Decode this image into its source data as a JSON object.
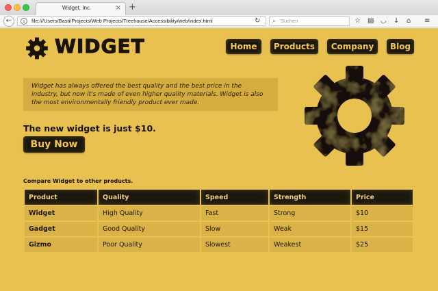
{
  "browser": {
    "tab_title": "Widget, Inc.",
    "tab_close": "×",
    "new_tab": "+",
    "url": "file:///Users/Basti/Projects/Web Projects/Treehouse/Accessibility/web/index.html",
    "search_placeholder": "Suchen"
  },
  "site": {
    "logo_text": "WIDGET",
    "nav": [
      "Home",
      "Products",
      "Company",
      "Blog"
    ],
    "intro": "Widget has always offered the best quality and the best price in the industry, but now it's made of even higher quality materials. Widget is also the most environmentally friendly product ever made.",
    "promo": "The new widget is just $10.",
    "buy_label": "Buy Now",
    "compare_caption": "Compare Widget to other products."
  },
  "table": {
    "headers": [
      "Product",
      "Quality",
      "Speed",
      "Strength",
      "Price"
    ],
    "rows": [
      [
        "Widget",
        "High Quality",
        "Fast",
        "Strong",
        "$10"
      ],
      [
        "Gadget",
        "Good Quality",
        "Slow",
        "Weak",
        "$15"
      ],
      [
        "Gizmo",
        "Poor Quality",
        "Slowest",
        "Weakest",
        "$25"
      ]
    ]
  },
  "colors": {
    "page_background": "#e8c150",
    "button_background": "#1c180f",
    "button_text": "#f0c74e",
    "intro_background": "#d4ac3f",
    "table_cell": "#d9b347"
  }
}
